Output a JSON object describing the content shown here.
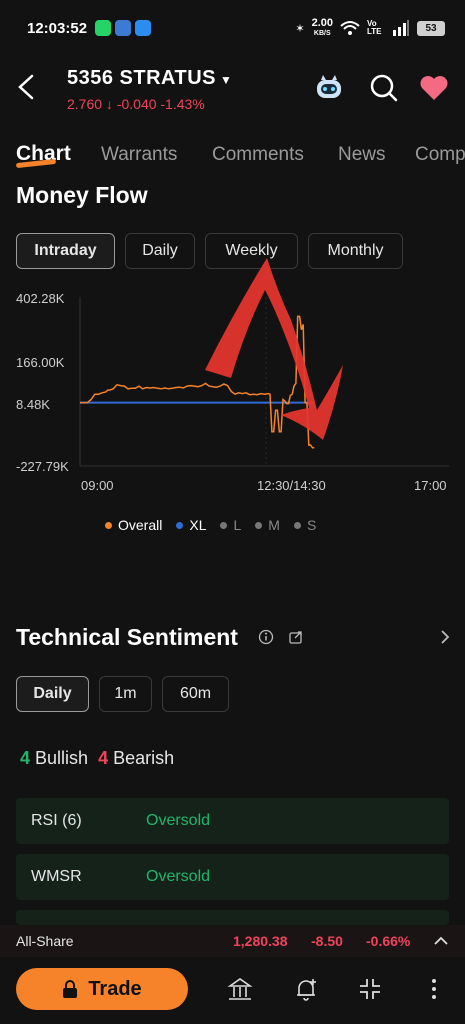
{
  "status_bar": {
    "time": "12:03:52",
    "net_speed": "2.00",
    "net_unit": "KB/S",
    "net_type": "Vo LTE",
    "battery": "53"
  },
  "header": {
    "title": "5356  STRATUS",
    "quote": "2.760 ↓ -0.040  -1.43%"
  },
  "tabs": [
    "Chart",
    "Warrants",
    "Comments",
    "News",
    "Comp"
  ],
  "money_flow": {
    "title": "Money Flow",
    "periods": [
      "Intraday",
      "Daily",
      "Weekly",
      "Monthly"
    ]
  },
  "chart_data": {
    "type": "line",
    "y_ticks": [
      "402.28K",
      "166.00K",
      "8.48K",
      "-227.79K"
    ],
    "x_ticks": [
      "09:00",
      "12:30/14:30",
      "17:00"
    ],
    "ylim": [
      -227790,
      402280
    ],
    "legend": [
      "Overall",
      "XL",
      "L",
      "M",
      "S"
    ],
    "series": [
      {
        "name": "Overall",
        "color": "#f6832a",
        "t": [
          0,
          4,
          6,
          8,
          10,
          12,
          14,
          15,
          16,
          18,
          20,
          22,
          24,
          26,
          28,
          30,
          32,
          34,
          36,
          38,
          40,
          42,
          44,
          46,
          48,
          50,
          52,
          54,
          56,
          58,
          60,
          62,
          64,
          66,
          68,
          70,
          72,
          74,
          76,
          78,
          80,
          82,
          84,
          86,
          88,
          90,
          92,
          94,
          96,
          98,
          100,
          102,
          103,
          104,
          105,
          106,
          107,
          108,
          109,
          110,
          111,
          112,
          113,
          114,
          115,
          116,
          117,
          118,
          119,
          120,
          121,
          122,
          123,
          124,
          125,
          126,
          127
        ],
        "values": [
          8480,
          8480,
          20000,
          40000,
          40000,
          45000,
          48000,
          55000,
          55000,
          60000,
          75000,
          72000,
          70000,
          60000,
          62000,
          62000,
          70000,
          60000,
          65000,
          63000,
          65000,
          62000,
          60000,
          63000,
          60000,
          62000,
          65000,
          66000,
          63000,
          70000,
          72000,
          70000,
          68000,
          72000,
          80000,
          70000,
          68000,
          66000,
          70000,
          78000,
          72000,
          50000,
          40000,
          45000,
          42000,
          45000,
          38000,
          40000,
          38000,
          42000,
          40000,
          42000,
          40000,
          -100000,
          -100000,
          -20000,
          -20000,
          -100000,
          -100000,
          20000,
          15000,
          5000,
          5000,
          35000,
          40000,
          70000,
          80000,
          330000,
          330000,
          280000,
          300000,
          8480,
          8480,
          -150000,
          -150000,
          -160000,
          -160000
        ]
      },
      {
        "name": "XL",
        "color": "#2f6bd6",
        "t": [
          0,
          127
        ],
        "values": [
          8480,
          8480
        ]
      }
    ]
  },
  "technical_sentiment": {
    "title": "Technical Sentiment",
    "periods": [
      "Daily",
      "1m",
      "60m"
    ],
    "bullish_count": "4",
    "bullish_label": "Bullish",
    "bearish_count": "4",
    "bearish_label": "Bearish",
    "indicators": [
      {
        "name": "RSI (6)",
        "value": "Oversold"
      },
      {
        "name": "WMSR",
        "value": "Oversold"
      }
    ]
  },
  "ticker": {
    "name": "All-Share",
    "value": "1,280.38",
    "change": "-8.50",
    "pct": "-0.66%"
  },
  "bottom_bar": {
    "trade_label": "Trade"
  }
}
